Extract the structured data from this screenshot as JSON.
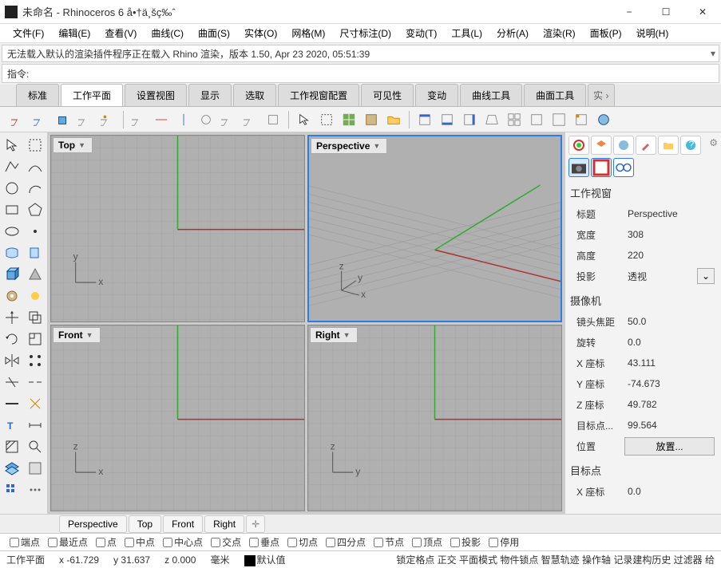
{
  "window": {
    "title": "未命名 - Rhinoceros 6 å•†ä¸šç‰ˆ",
    "minimize": "−",
    "maximize": "☐",
    "close": "✕"
  },
  "menubar": [
    "文件(F)",
    "编辑(E)",
    "查看(V)",
    "曲线(C)",
    "曲面(S)",
    "实体(O)",
    "网格(M)",
    "尺寸标注(D)",
    "变动(T)",
    "工具(L)",
    "分析(A)",
    "渲染(R)",
    "面板(P)",
    "说明(H)"
  ],
  "cmd_history": "无法载入默认的渲染插件程序正在载入 Rhino 渲染，版本 1.50, Apr 23 2020, 05:51:39",
  "cmd_prompt": "指令:",
  "toolbar_tabs": [
    "标准",
    "工作平面",
    "设置视图",
    "显示",
    "选取",
    "工作视窗配置",
    "可见性",
    "变动",
    "曲线工具",
    "曲面工具"
  ],
  "toolbar_more": "实 ›",
  "viewports": {
    "tl": "Top",
    "tr": "Perspective",
    "bl": "Front",
    "br": "Right"
  },
  "rpanel": {
    "sec1": "工作视窗",
    "title_k": "标题",
    "title_v": "Perspective",
    "width_k": "宽度",
    "width_v": "308",
    "height_k": "高度",
    "height_v": "220",
    "proj_k": "投影",
    "proj_v": "透视",
    "sec2": "摄像机",
    "focal_k": "镜头焦距",
    "focal_v": "50.0",
    "rot_k": "旋转",
    "rot_v": "0.0",
    "x_k": "X 座标",
    "x_v": "43.111",
    "y_k": "Y 座标",
    "y_v": "-74.673",
    "z_k": "Z 座标",
    "z_v": "49.782",
    "target_k": "目标点...",
    "target_v": "99.564",
    "pos_k": "位置",
    "pos_btn": "放置...",
    "sec3": "目标点",
    "tx_k": "X 座标",
    "tx_v": "0.0"
  },
  "bottom_tabs": [
    "Perspective",
    "Top",
    "Front",
    "Right"
  ],
  "osnap": [
    "端点",
    "最近点",
    "点",
    "中点",
    "中心点",
    "交点",
    "垂点",
    "切点",
    "四分点",
    "节点",
    "顶点",
    "投影",
    "停用"
  ],
  "status": {
    "plane": "工作平面",
    "x": "x -61.729",
    "y": "y 31.637",
    "z": "z 0.000",
    "unit": "毫米",
    "layer": "默认值",
    "rest": "锁定格点 正交 平面模式 物件锁点 智慧轨迹 操作轴 记录建构历史 过滤器 给"
  }
}
